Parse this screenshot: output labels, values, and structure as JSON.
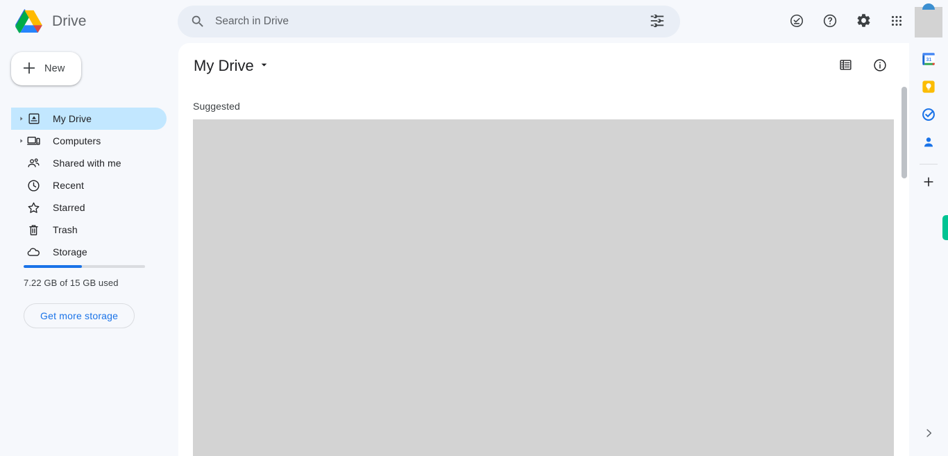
{
  "app": {
    "brand_name": "Drive",
    "brand_logo_icon": "google-drive-logo"
  },
  "search": {
    "placeholder": "Search in Drive",
    "value": "",
    "search_icon": "search-icon",
    "filter_icon": "tune-filter-icon"
  },
  "topbar_icons": [
    {
      "name": "offline-status-icon",
      "label": "Offline status"
    },
    {
      "name": "help-icon",
      "label": "Support"
    },
    {
      "name": "settings-gear-icon",
      "label": "Settings"
    },
    {
      "name": "google-apps-grid-icon",
      "label": "Google apps"
    }
  ],
  "sidebar": {
    "new_button": {
      "label": "New",
      "icon": "plus-icon"
    },
    "items": [
      {
        "label": "My Drive",
        "icon": "my-drive-icon",
        "expandable": true,
        "active": true
      },
      {
        "label": "Computers",
        "icon": "computers-icon",
        "expandable": true,
        "active": false
      },
      {
        "label": "Shared with me",
        "icon": "shared-with-me-icon",
        "expandable": false,
        "active": false
      },
      {
        "label": "Recent",
        "icon": "clock-icon",
        "expandable": false,
        "active": false
      },
      {
        "label": "Starred",
        "icon": "star-icon",
        "expandable": false,
        "active": false
      },
      {
        "label": "Trash",
        "icon": "trash-icon",
        "expandable": false,
        "active": false
      },
      {
        "label": "Storage",
        "icon": "cloud-icon",
        "expandable": false,
        "active": false
      }
    ],
    "storage": {
      "used_text": "7.22 GB of 15 GB used",
      "used_percent": 48,
      "bar_color": "#1a73e8",
      "button_label": "Get more storage"
    }
  },
  "main": {
    "title": "My Drive",
    "title_caret_icon": "chevron-down-icon",
    "section_label": "Suggested",
    "actions": [
      {
        "name": "list-view-icon",
        "label": "List layout"
      },
      {
        "name": "info-icon",
        "label": "View details"
      }
    ]
  },
  "right_rail": {
    "apps": [
      {
        "name": "google-calendar-icon",
        "label": "Calendar",
        "day": "31"
      },
      {
        "name": "google-keep-icon",
        "label": "Keep"
      },
      {
        "name": "google-tasks-icon",
        "label": "Tasks"
      },
      {
        "name": "google-contacts-icon",
        "label": "Contacts"
      }
    ],
    "add_button": {
      "name": "add-apps-icon",
      "label": "Get add-ons"
    },
    "expand_button": {
      "name": "chevron-right-icon",
      "label": "Show side panel"
    },
    "accent_tab_color": "#00c493"
  }
}
